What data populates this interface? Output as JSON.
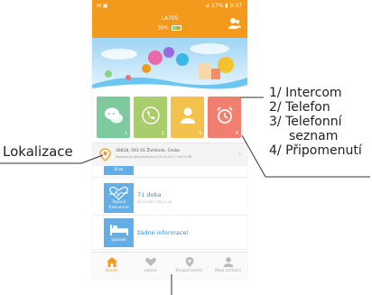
{
  "statusbar": {
    "left": "✉ ▣",
    "right": "⊿ 17% ▮ 9:37"
  },
  "header": {
    "device": "LA705",
    "battery": "39%"
  },
  "tiles": [
    {
      "num": "1",
      "color": "#7ec99d",
      "icon": "chat-icon"
    },
    {
      "num": "2",
      "color": "#a8cd6a",
      "icon": "phone-icon"
    },
    {
      "num": "3",
      "color": "#f3c24b",
      "icon": "contact-icon"
    },
    {
      "num": "4",
      "color": "#f07f6f",
      "icon": "alarm-clock-icon"
    }
  ],
  "location": {
    "address": "36818, 563 01 Žichlinek, Česko",
    "updated": "Naposledy aktualizováno:03-10-2017 08:29:36"
  },
  "cards": [
    {
      "label_top": "Krok",
      "title": "",
      "sub": ""
    },
    {
      "label_top": "Tepová",
      "label_bottom": "frekvence",
      "title": "71 doba",
      "sub": "03-10-2017 06:11:24"
    },
    {
      "label_top": "Spánek",
      "title": "žádné informace!",
      "sub": ""
    }
  ],
  "nav": [
    {
      "label": "Domů",
      "icon": "home-icon",
      "active": true
    },
    {
      "label": "zdraví",
      "icon": "heart-icon",
      "active": false
    },
    {
      "label": "Bezpečnostní",
      "icon": "location-pin-icon",
      "active": false
    },
    {
      "label": "Moje zařízení",
      "icon": "person-icon",
      "active": false
    }
  ],
  "annotations": {
    "lokalizace": "Lokalizace",
    "list": [
      "1/ Intercom",
      "2/ Telefon",
      "3/ Telefonní",
      "seznam",
      "4/ Připomenutí"
    ]
  },
  "colors": {
    "accent": "#f39a1c",
    "card_blue": "#62aee6",
    "title_blue": "#3a8fd4"
  }
}
